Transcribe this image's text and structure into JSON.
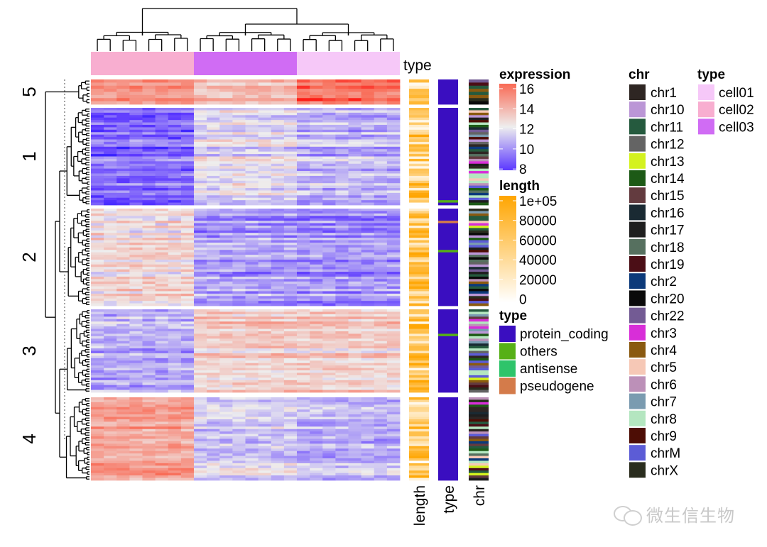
{
  "chart_data": {
    "type": "heatmap",
    "title": "",
    "columns": {
      "count": 24,
      "groups": [
        {
          "name": "cell02",
          "n": 8
        },
        {
          "name": "cell03",
          "n": 8
        },
        {
          "name": "cell01",
          "n": 8
        }
      ],
      "annotation_label": "type"
    },
    "row_slices": [
      {
        "label": "5",
        "n_rows": 8,
        "profile": [
          15.2,
          14.0,
          16.0
        ]
      },
      {
        "label": "1",
        "n_rows": 40,
        "profile": [
          9.2,
          11.8,
          10.8
        ]
      },
      {
        "label": "2",
        "n_rows": 40,
        "profile": [
          12.6,
          10.2,
          9.9
        ]
      },
      {
        "label": "3",
        "n_rows": 34,
        "profile": [
          10.6,
          13.0,
          13.0
        ]
      },
      {
        "label": "4",
        "n_rows": 34,
        "profile": [
          14.6,
          11.6,
          11.0
        ]
      }
    ],
    "row_annotations": {
      "bottom_labels": [
        "length",
        "type",
        "chr"
      ]
    },
    "legends": {
      "expression": {
        "title": "expression",
        "ticks": [
          "16",
          "14",
          "12",
          "10",
          "8"
        ],
        "range": [
          8,
          16
        ],
        "colors": {
          "low": "#5b37ff",
          "mid": "#eeeeee",
          "high": "#f96a55"
        }
      },
      "length": {
        "title": "length",
        "ticks": [
          "1e+05",
          "80000",
          "60000",
          "40000",
          "20000",
          "0"
        ],
        "range": [
          0,
          100000
        ],
        "colors": {
          "low": "#ffffff",
          "high": "#ffa500"
        }
      },
      "row_type": {
        "title": "type",
        "items": [
          {
            "label": "protein_coding",
            "color": "#3a0ec0"
          },
          {
            "label": "others",
            "color": "#56b017"
          },
          {
            "label": "antisense",
            "color": "#2ec46a"
          },
          {
            "label": "pseudogene",
            "color": "#d47b4a"
          }
        ]
      },
      "chr": {
        "title": "chr",
        "items": [
          {
            "label": "chr1",
            "color": "#2e2623"
          },
          {
            "label": "chr10",
            "color": "#bb96d6"
          },
          {
            "label": "chr11",
            "color": "#255a3e"
          },
          {
            "label": "chr12",
            "color": "#646464"
          },
          {
            "label": "chr13",
            "color": "#d4f21f"
          },
          {
            "label": "chr14",
            "color": "#1d5a16"
          },
          {
            "label": "chr15",
            "color": "#633b3f"
          },
          {
            "label": "chr16",
            "color": "#1a2a33"
          },
          {
            "label": "chr17",
            "color": "#1e1e1e"
          },
          {
            "label": "chr18",
            "color": "#56705f"
          },
          {
            "label": "chr19",
            "color": "#4b0e16"
          },
          {
            "label": "chr2",
            "color": "#0c3a7a"
          },
          {
            "label": "chr20",
            "color": "#0a0a0a"
          },
          {
            "label": "chr22",
            "color": "#735b94"
          },
          {
            "label": "chr3",
            "color": "#d82ed8"
          },
          {
            "label": "chr4",
            "color": "#8a5a10"
          },
          {
            "label": "chr5",
            "color": "#f6c8b6"
          },
          {
            "label": "chr6",
            "color": "#bc90b8"
          },
          {
            "label": "chr7",
            "color": "#7a9bb0"
          },
          {
            "label": "chr8",
            "color": "#b4e6c0"
          },
          {
            "label": "chr9",
            "color": "#4d0d05"
          },
          {
            "label": "chrM",
            "color": "#5c5cd6"
          },
          {
            "label": "chrX",
            "color": "#2a2d1e"
          }
        ]
      },
      "col_type": {
        "title": "type",
        "items": [
          {
            "label": "cell01",
            "color": "#f6c8f8"
          },
          {
            "label": "cell02",
            "color": "#f8aed0"
          },
          {
            "label": "cell03",
            "color": "#d06cf4"
          }
        ]
      }
    }
  },
  "watermark": {
    "text": "微生信生物",
    "icon": "wechat-icon"
  }
}
